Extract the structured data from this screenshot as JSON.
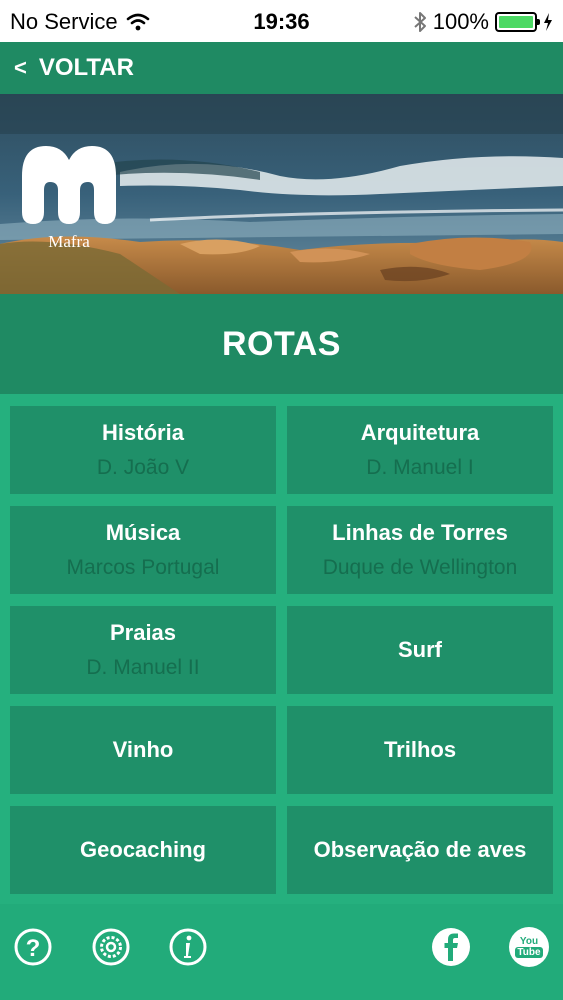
{
  "status_bar": {
    "carrier": "No Service",
    "time": "19:36",
    "battery": "100%"
  },
  "nav": {
    "back_chevron": "<",
    "back_label": "VOLTAR"
  },
  "banner": {
    "logo_label": "Mafra"
  },
  "page_title": "ROTAS",
  "routes": [
    {
      "title": "História",
      "subtitle": "D. João V"
    },
    {
      "title": "Arquitetura",
      "subtitle": "D. Manuel I"
    },
    {
      "title": "Música",
      "subtitle": "Marcos Portugal"
    },
    {
      "title": "Linhas de Torres",
      "subtitle": "Duque de Wellington"
    },
    {
      "title": "Praias",
      "subtitle": "D. Manuel II"
    },
    {
      "title": "Surf",
      "subtitle": ""
    },
    {
      "title": "Vinho",
      "subtitle": ""
    },
    {
      "title": "Trilhos",
      "subtitle": ""
    },
    {
      "title": "Geocaching",
      "subtitle": ""
    },
    {
      "title": "Observação de aves",
      "subtitle": ""
    }
  ],
  "footer": {
    "icons": [
      "help-icon",
      "settings-icon",
      "info-icon",
      "facebook-icon",
      "youtube-icon"
    ],
    "youtube_top": "You",
    "youtube_bottom": "Tube"
  },
  "colors": {
    "accent": "#1f8a63",
    "grid_bg": "#25b07e",
    "tile_bg": "#1f9069",
    "subtitle": "#156e4f"
  }
}
